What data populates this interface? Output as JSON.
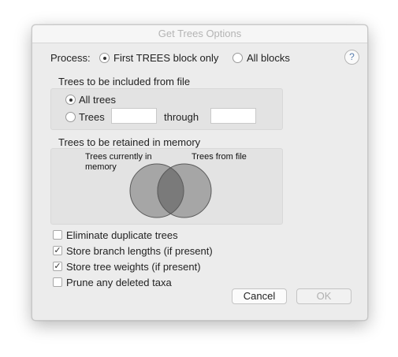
{
  "window": {
    "title": "Get Trees Options"
  },
  "process": {
    "label": "Process:",
    "options": [
      "First TREES block only",
      "All blocks"
    ],
    "selected": "First TREES block only"
  },
  "help": {
    "glyph": "?"
  },
  "include_section": {
    "title": "Trees to be included from file",
    "all_trees_label": "All trees",
    "trees_label": "Trees",
    "through_label": "through",
    "from_value": "",
    "to_value": "",
    "selected": "All trees"
  },
  "retain_section": {
    "title": "Trees to be retained in memory",
    "left_circle_label": "Trees currently in memory",
    "right_circle_label": "Trees from file"
  },
  "checkboxes": [
    {
      "label": "Eliminate duplicate trees",
      "checked": false
    },
    {
      "label": "Store branch lengths (if present)",
      "checked": true
    },
    {
      "label": "Store tree weights (if present)",
      "checked": true
    },
    {
      "label": "Prune any deleted taxa",
      "checked": false
    }
  ],
  "check_glyph": "✓",
  "buttons": {
    "cancel": "Cancel",
    "ok": "OK"
  }
}
